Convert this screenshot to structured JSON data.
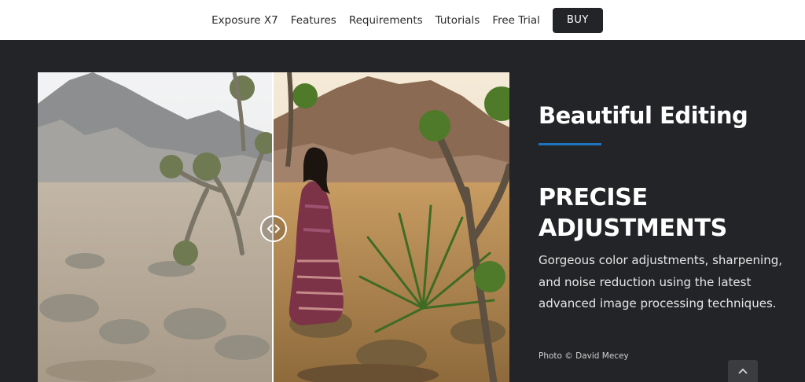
{
  "nav": {
    "items": [
      {
        "label": "Exposure X7"
      },
      {
        "label": "Features"
      },
      {
        "label": "Requirements"
      },
      {
        "label": "Tutorials"
      },
      {
        "label": "Free Trial"
      }
    ],
    "buy_label": "BUY"
  },
  "feature": {
    "heading": "Beautiful Editing",
    "subheading": "PRECISE ADJUSTMENTS",
    "description": "Gorgeous color adjustments, sharpening, and noise reduction using the latest advanced image processing techniques.",
    "credit": "Photo © David Mecey"
  },
  "compare_slider": {
    "position": 0.5
  },
  "colors": {
    "background": "#232427",
    "accent": "#1e73be",
    "nav_bg": "#ffffff",
    "buy_bg": "#232427"
  },
  "icons": {
    "slider_handle": "double-chevron-icon",
    "scroll_top": "chevron-up-icon"
  }
}
